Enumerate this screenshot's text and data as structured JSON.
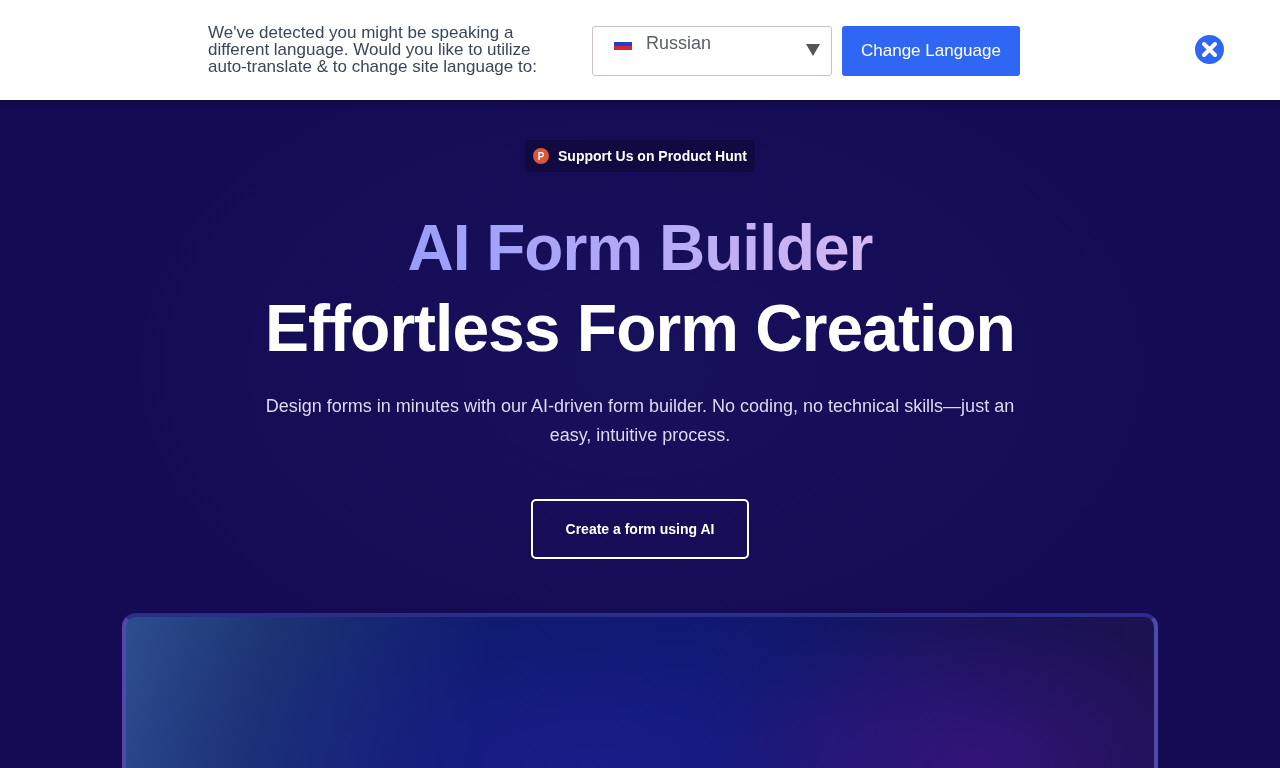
{
  "language_banner": {
    "message": "We've detected you might be speaking a different language. Would you like to utilize auto-translate & to change site language to:",
    "language_select": {
      "value": "Russian"
    },
    "button": "Change Language"
  },
  "hero": {
    "badge": {
      "icon_letter": "P",
      "label": "Support Us on Product Hunt"
    },
    "title": "AI Form Builder",
    "subtitle": "Effortless Form Creation",
    "description": "Design forms in minutes with our AI-driven form builder. No coding, no technical skills—just an easy, intuitive process.",
    "cta": "Create a form using AI"
  }
}
